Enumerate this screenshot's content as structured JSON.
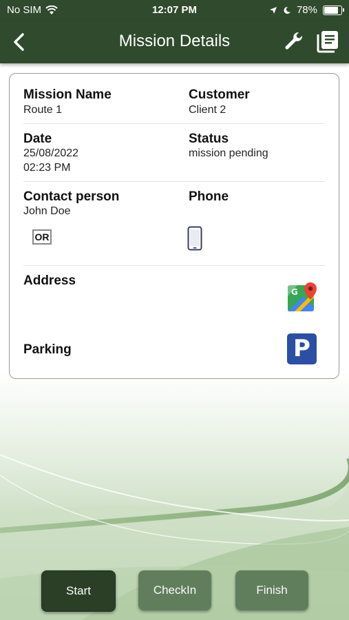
{
  "status_bar": {
    "carrier": "No SIM",
    "time": "12:07 PM",
    "battery": "78%"
  },
  "nav": {
    "title": "Mission Details"
  },
  "mission": {
    "name_label": "Mission Name",
    "name_value": "Route 1",
    "customer_label": "Customer",
    "customer_value": "Client 2",
    "date_label": "Date",
    "date_value": "25/08/2022",
    "time_value": "02:23 PM",
    "status_label": "Status",
    "status_value": "mission pending",
    "contact_label": "Contact person",
    "contact_value": "John Doe",
    "or_badge": "OR",
    "phone_label": "Phone",
    "address_label": "Address",
    "parking_label": "Parking",
    "parking_symbol": "P"
  },
  "buttons": {
    "start": "Start",
    "checkin": "CheckIn",
    "finish": "Finish"
  },
  "colors": {
    "header": "#2f4a2c",
    "start_button": "#2b3f27",
    "secondary_button": "#5c7a58",
    "parking_blue": "#2b4fa5"
  }
}
